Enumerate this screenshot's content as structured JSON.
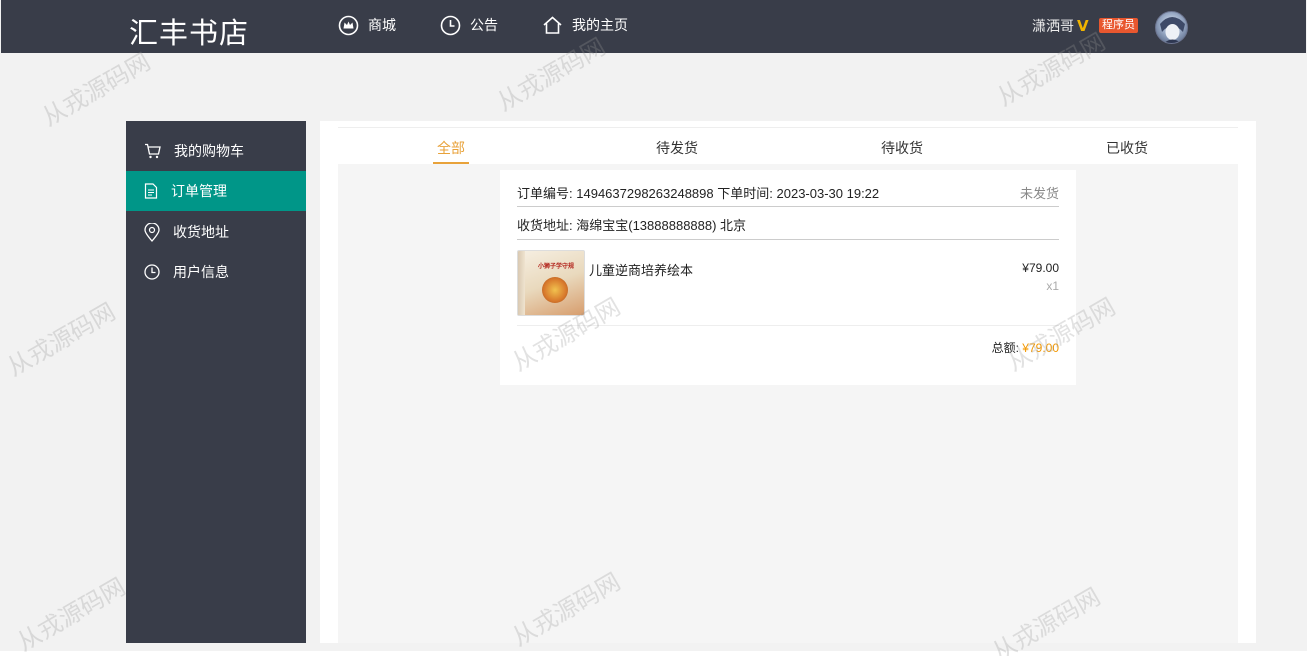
{
  "header": {
    "logo": "汇丰书店",
    "nav": [
      {
        "label": "商城",
        "icon": "crown-icon"
      },
      {
        "label": "公告",
        "icon": "clock-icon"
      },
      {
        "label": "我的主页",
        "icon": "home-icon"
      }
    ],
    "user": {
      "name": "潇洒哥",
      "vip_mark": "V",
      "role": "程序员"
    }
  },
  "sidebar": {
    "items": [
      {
        "label": "我的购物车",
        "icon": "cart-icon",
        "active": false
      },
      {
        "label": "订单管理",
        "icon": "document-icon",
        "active": true
      },
      {
        "label": "收货地址",
        "icon": "location-pin-icon",
        "active": false
      },
      {
        "label": "用户信息",
        "icon": "clock-icon",
        "active": false
      }
    ]
  },
  "tabs": [
    {
      "label": "全部",
      "active": true
    },
    {
      "label": "待发货",
      "active": false
    },
    {
      "label": "待收货",
      "active": false
    },
    {
      "label": "已收货",
      "active": false
    }
  ],
  "order": {
    "number_label": "订单编号:",
    "number": "1494637298263248898",
    "time_label": "下单时间:",
    "time": "2023-03-30 19:22",
    "status": "未发货",
    "address_label": "收货地址:",
    "address": "海绵宝宝(13888888888) 北京",
    "item": {
      "name": "儿童逆商培养绘本",
      "cover_text": "小狮子学守规",
      "price": "¥79.00",
      "qty": "x1"
    },
    "total_label": "总额:",
    "total": "¥79.00"
  },
  "watermark": "从戎源码网",
  "colors": {
    "header_bg": "#393d49",
    "sidebar_active": "#009688",
    "tab_active": "#e8a23a",
    "price_accent": "#f39800",
    "role_badge": "#e8572f"
  }
}
